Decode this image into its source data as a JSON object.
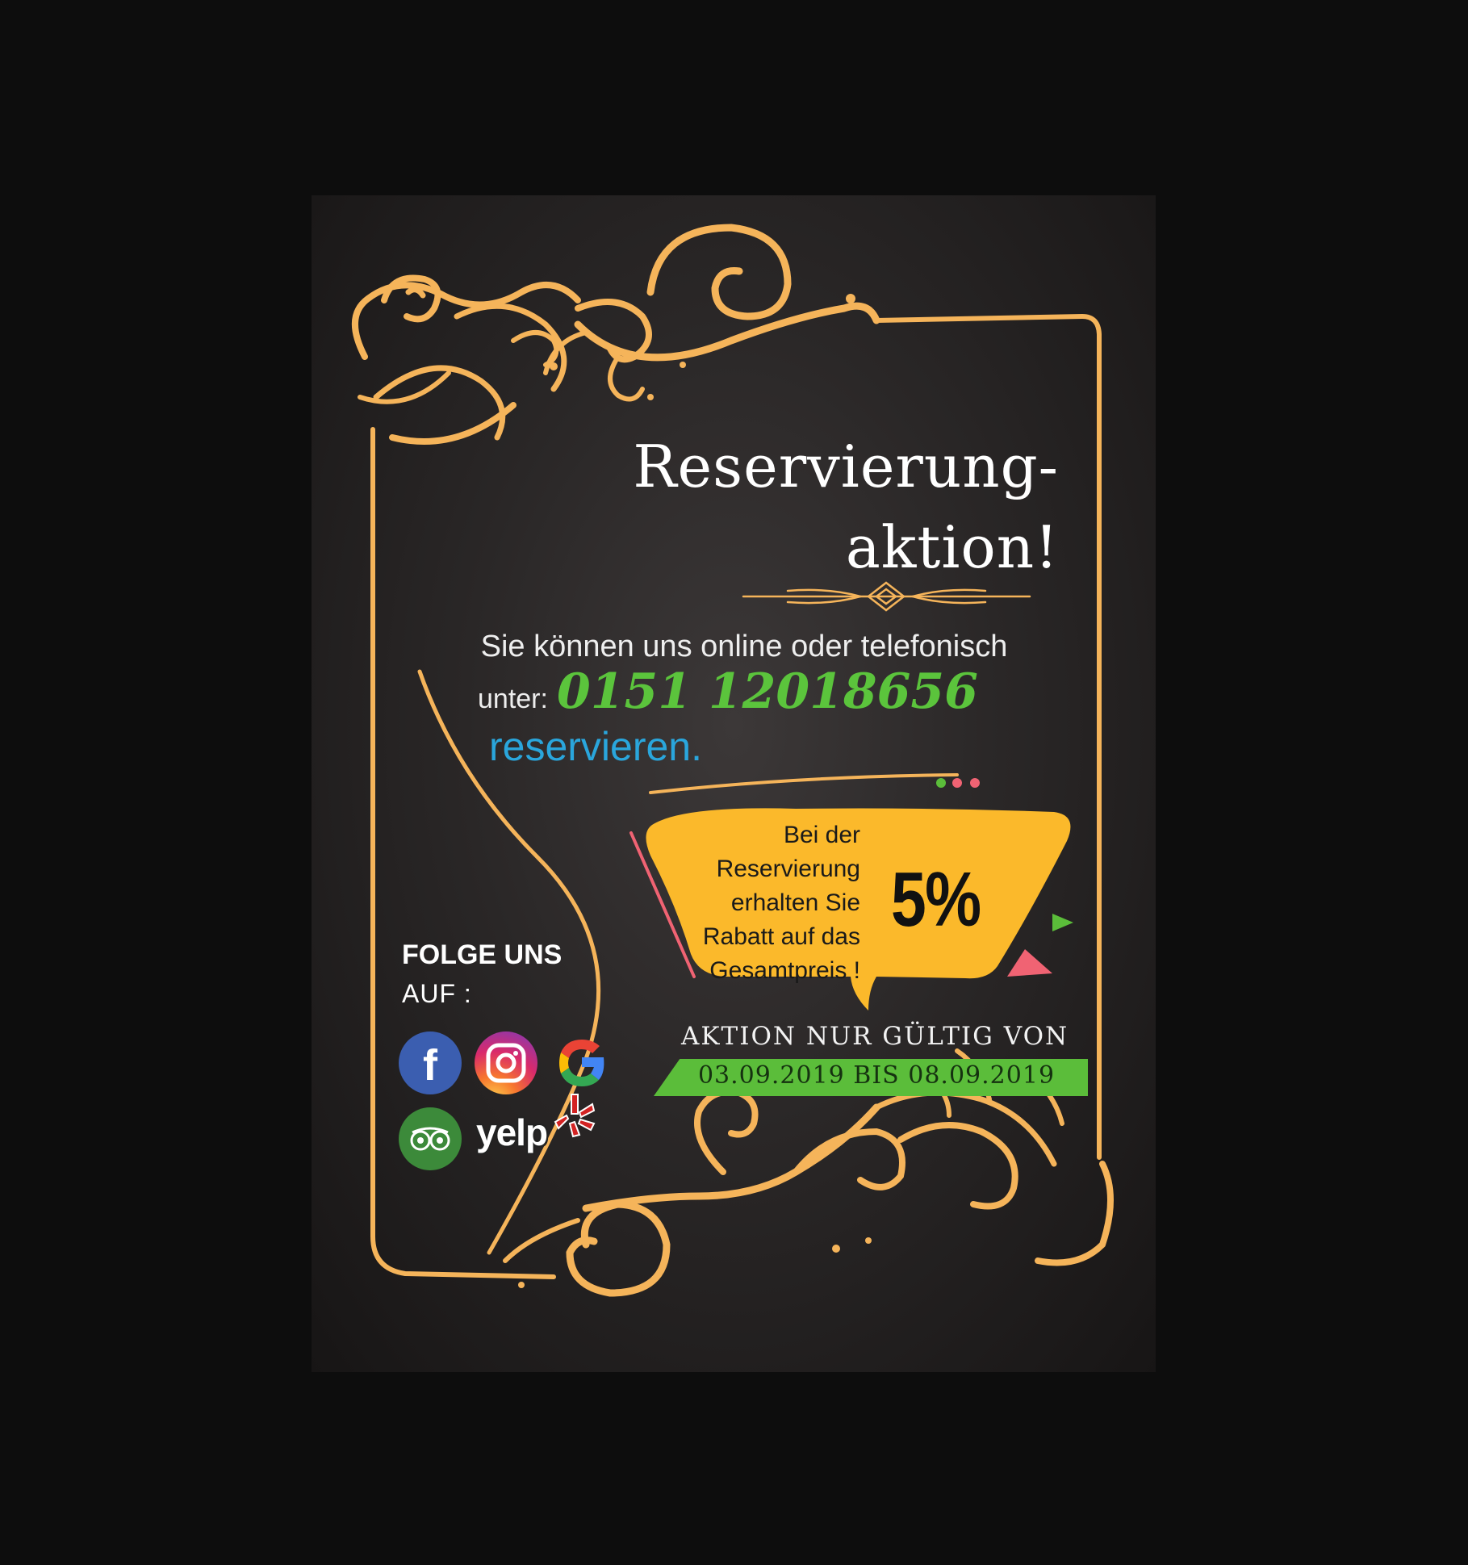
{
  "title": {
    "line1": "Reservierung-",
    "line2": "aktion!"
  },
  "intro": {
    "line1": "Sie können uns online oder telefonisch",
    "unter_label": "unter:",
    "phone": "0151 12018656",
    "reserve": "reservieren."
  },
  "offer": {
    "text_lines": [
      "Bei der Reservierung",
      "erhalten Sie",
      "Rabatt auf das",
      "Gesamtpreis !"
    ],
    "percent": "5%"
  },
  "validity": {
    "label": "AKTION NUR GÜLTIG VON",
    "dates": "03.09.2019  BIS  08.09.2019"
  },
  "social": {
    "heading": "FOLGE UNS",
    "subheading": "AUF :",
    "icons": [
      "facebook-icon",
      "instagram-icon",
      "google-icon",
      "tripadvisor-icon",
      "yelp-icon"
    ],
    "yelp_wordmark": "yelp"
  },
  "colors": {
    "gold": "#f5b45a",
    "phone_green": "#5bc43c",
    "reserve_blue": "#2aa6dc",
    "bubble_yellow": "#fbb92b",
    "bar_green": "#5bbd3a",
    "pink": "#f06373"
  }
}
